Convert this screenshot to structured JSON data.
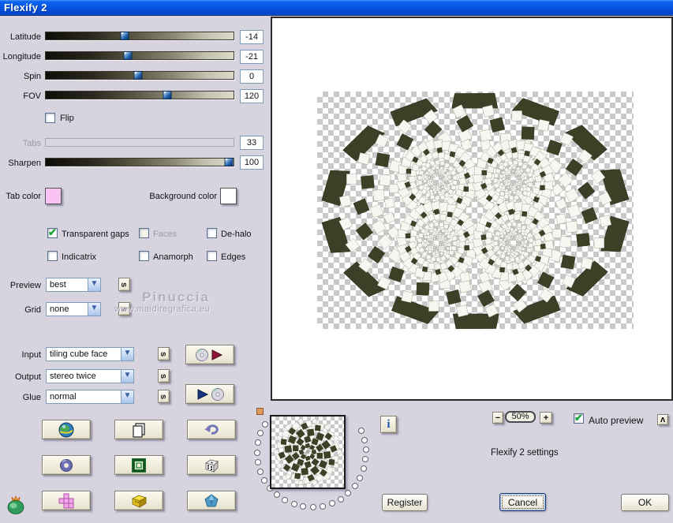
{
  "window": {
    "title": "Flexify 2"
  },
  "sliders": {
    "rows": [
      {
        "label": "Latitude",
        "value": "-14"
      },
      {
        "label": "Longitude",
        "value": "-21"
      },
      {
        "label": "Spin",
        "value": "0"
      },
      {
        "label": "FOV",
        "value": "120"
      },
      {
        "label": "Tabs",
        "value": "33"
      },
      {
        "label": "Sharpen",
        "value": "100"
      }
    ]
  },
  "flip": {
    "label": "Flip",
    "checked": false
  },
  "colors": {
    "tab_color_label": "Tab color",
    "tab_color": "#f8c2f2",
    "background_color_label": "Background color",
    "background_color": "#ffffff"
  },
  "checkboxes": {
    "transparent_gaps": {
      "label": "Transparent gaps",
      "checked": true
    },
    "faces": {
      "label": "Faces",
      "checked": false,
      "disabled": true
    },
    "dehalo": {
      "label": "De-halo",
      "checked": false
    },
    "indicatrix": {
      "label": "Indicatrix",
      "checked": false
    },
    "anamorph": {
      "label": "Anamorph",
      "checked": false
    },
    "edges": {
      "label": "Edges",
      "checked": false
    }
  },
  "selects": {
    "preview": {
      "label": "Preview",
      "value": "best"
    },
    "grid": {
      "label": "Grid",
      "value": "none"
    },
    "input": {
      "label": "Input",
      "value": "tiling cube face"
    },
    "output": {
      "label": "Output",
      "value": "stereo twice"
    },
    "glue": {
      "label": "Glue",
      "value": "normal"
    }
  },
  "watermark": {
    "line1": "Pinuccia",
    "line2": "www.maidiregrafica.eu"
  },
  "zoom": {
    "minus": "−",
    "value": "50%",
    "plus": "+"
  },
  "auto_preview": {
    "label": "Auto preview",
    "checked": true
  },
  "settings_text": "Flexify 2 settings",
  "buttons": {
    "register": "Register",
    "cancel": "Cancel",
    "ok": "OK"
  },
  "glyphs": {
    "check": "✔",
    "chevron": "▼",
    "caret": "ʌ",
    "info": "i",
    "s": "s"
  },
  "pattern": {
    "dark": "#3a4126",
    "light": "#f7f7f1",
    "lattice_stroke": "#8d927c",
    "checker": "#c9c9c9"
  }
}
